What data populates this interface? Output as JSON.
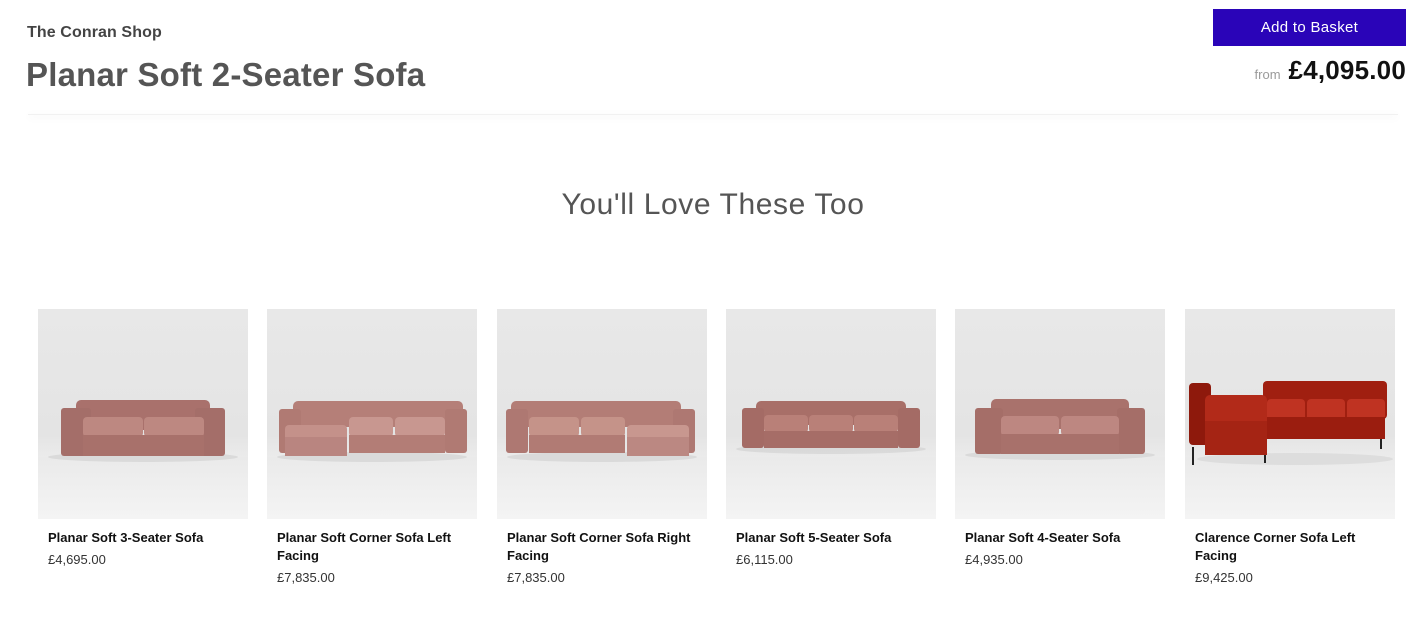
{
  "header": {
    "brand": "The Conran Shop",
    "product_title": "Planar Soft 2-Seater Sofa",
    "add_to_basket_label": "Add to Basket",
    "price_prefix": "from",
    "price": "£4,095.00",
    "accent_color": "#2a04b8"
  },
  "recommendations": {
    "title": "You'll Love These Too",
    "items": [
      {
        "name": "Planar Soft 3-Seater Sofa",
        "price": "£4,695.00",
        "image": "pink-3-seater-sofa"
      },
      {
        "name": "Planar Soft Corner Sofa Left Facing",
        "price": "£7,835.00",
        "image": "pink-corner-sofa-left"
      },
      {
        "name": "Planar Soft Corner Sofa Right Facing",
        "price": "£7,835.00",
        "image": "pink-corner-sofa-right"
      },
      {
        "name": "Planar Soft 5-Seater Sofa",
        "price": "£6,115.00",
        "image": "pink-5-seater-sofa"
      },
      {
        "name": "Planar Soft 4-Seater Sofa",
        "price": "£4,935.00",
        "image": "pink-4-seater-sofa"
      },
      {
        "name": "Clarence Corner Sofa Left Facing",
        "price": "£9,425.00",
        "image": "red-velvet-corner-sofa"
      }
    ]
  },
  "colors": {
    "sofa_pink": "#b77f79",
    "sofa_red": "#a82414"
  }
}
